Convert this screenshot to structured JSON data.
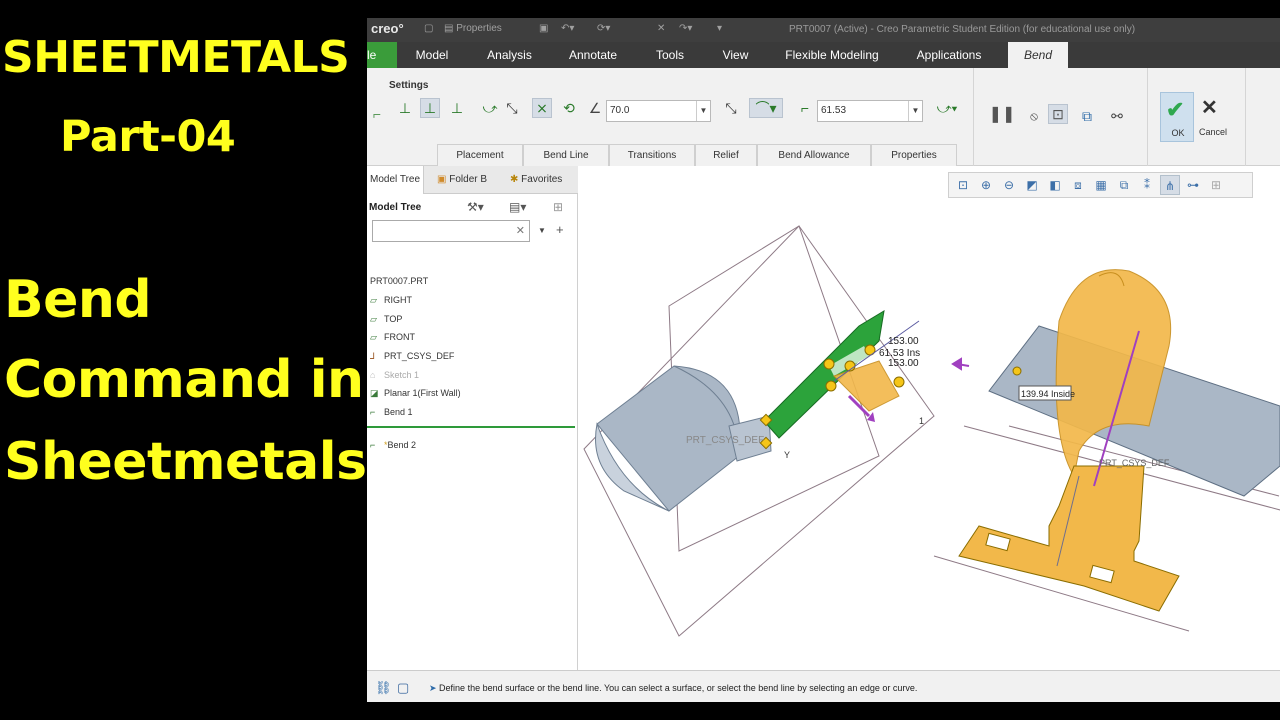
{
  "overlay": {
    "line1": "SHEETMETALS",
    "line2": "Part-04",
    "line3": "Bend",
    "line4": "Command in",
    "line5": "Sheetmetals",
    "color": "#ffff1e"
  },
  "titlebar": {
    "logo": "creo°",
    "properties": "Properties",
    "window_title": "PRT0007 (Active) - Creo Parametric Student Edition (for educational use only)"
  },
  "ribbon_tabs": [
    "le",
    "Model",
    "Analysis",
    "Annotate",
    "Tools",
    "View",
    "Flexible Modeling",
    "Applications",
    "Bend"
  ],
  "dashboard": {
    "settings_label": "Settings",
    "angle_value": "70.0",
    "radius_value": "61.53",
    "ok_label": "OK",
    "cancel_label": "Cancel",
    "subtabs": [
      "Placement",
      "Bend Line",
      "Transitions",
      "Relief",
      "Bend Allowance",
      "Properties"
    ]
  },
  "tree": {
    "tabs": [
      "Model Tree",
      "Folder B",
      "Favorites"
    ],
    "header": "Model Tree",
    "items": [
      {
        "label": "PRT0007.PRT",
        "icon": "part-icon",
        "state": "normal"
      },
      {
        "label": "RIGHT",
        "icon": "datum-plane-icon",
        "state": "normal"
      },
      {
        "label": "TOP",
        "icon": "datum-plane-icon",
        "state": "normal"
      },
      {
        "label": "FRONT",
        "icon": "datum-plane-icon",
        "state": "normal"
      },
      {
        "label": "PRT_CSYS_DEF",
        "icon": "csys-icon",
        "state": "normal"
      },
      {
        "label": "Sketch 1",
        "icon": "sketch-icon",
        "state": "dim"
      },
      {
        "label": "Planar 1(First Wall)",
        "icon": "planar-wall-icon",
        "state": "normal"
      },
      {
        "label": "Bend 1",
        "icon": "bend-icon",
        "state": "normal"
      },
      {
        "label": "Bend 2",
        "icon": "bend-icon",
        "state": "active"
      }
    ]
  },
  "viewport": {
    "dim1": "153.00",
    "dim2": "61.53 Ins",
    "dim3": "153.00",
    "dim4": "139.94 Inside",
    "csys1": "PRT_CSYS_DEF",
    "csys2": "PRT_CSYS_DEF",
    "axis_y": "Y",
    "marker": "1"
  },
  "status": {
    "message": "Define the bend surface or the bend line. You can select a surface, or select the bend line by selecting an edge or curve."
  }
}
